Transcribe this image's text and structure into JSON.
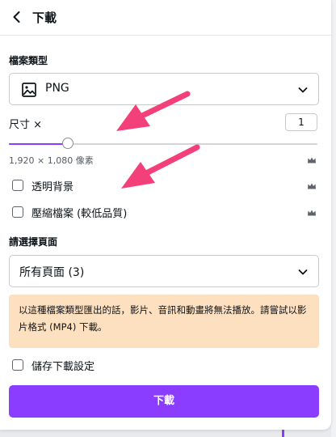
{
  "header": {
    "title": "下載"
  },
  "file_type": {
    "label": "檔案類型",
    "value": "PNG"
  },
  "size": {
    "label": "尺寸 ×",
    "multiplier": "1",
    "slider_level": 0.19,
    "dimensions": "1,920 × 1,080 像素"
  },
  "options": {
    "transparent_bg": {
      "label": "透明背景",
      "checked": false
    },
    "compress": {
      "label": "壓縮檔案 (較低品質)",
      "checked": false
    }
  },
  "pages": {
    "label": "請選擇頁面",
    "value": "所有頁面 (3)"
  },
  "notice": {
    "text": "以這種檔案類型匯出的話，影片、音訊和動畫將無法播放。請嘗試以影片格式 (MP4) 下載。"
  },
  "save_settings": {
    "label": "儲存下載設定",
    "checked": false
  },
  "download_button": {
    "label": "下載"
  },
  "colors": {
    "accent": "#8b3dff",
    "notice_bg": "#fde0c0",
    "annotation_arrow": "#f4407a"
  },
  "icons": [
    "chevron-left-icon",
    "image-icon",
    "chevron-down-icon",
    "crown-icon"
  ]
}
